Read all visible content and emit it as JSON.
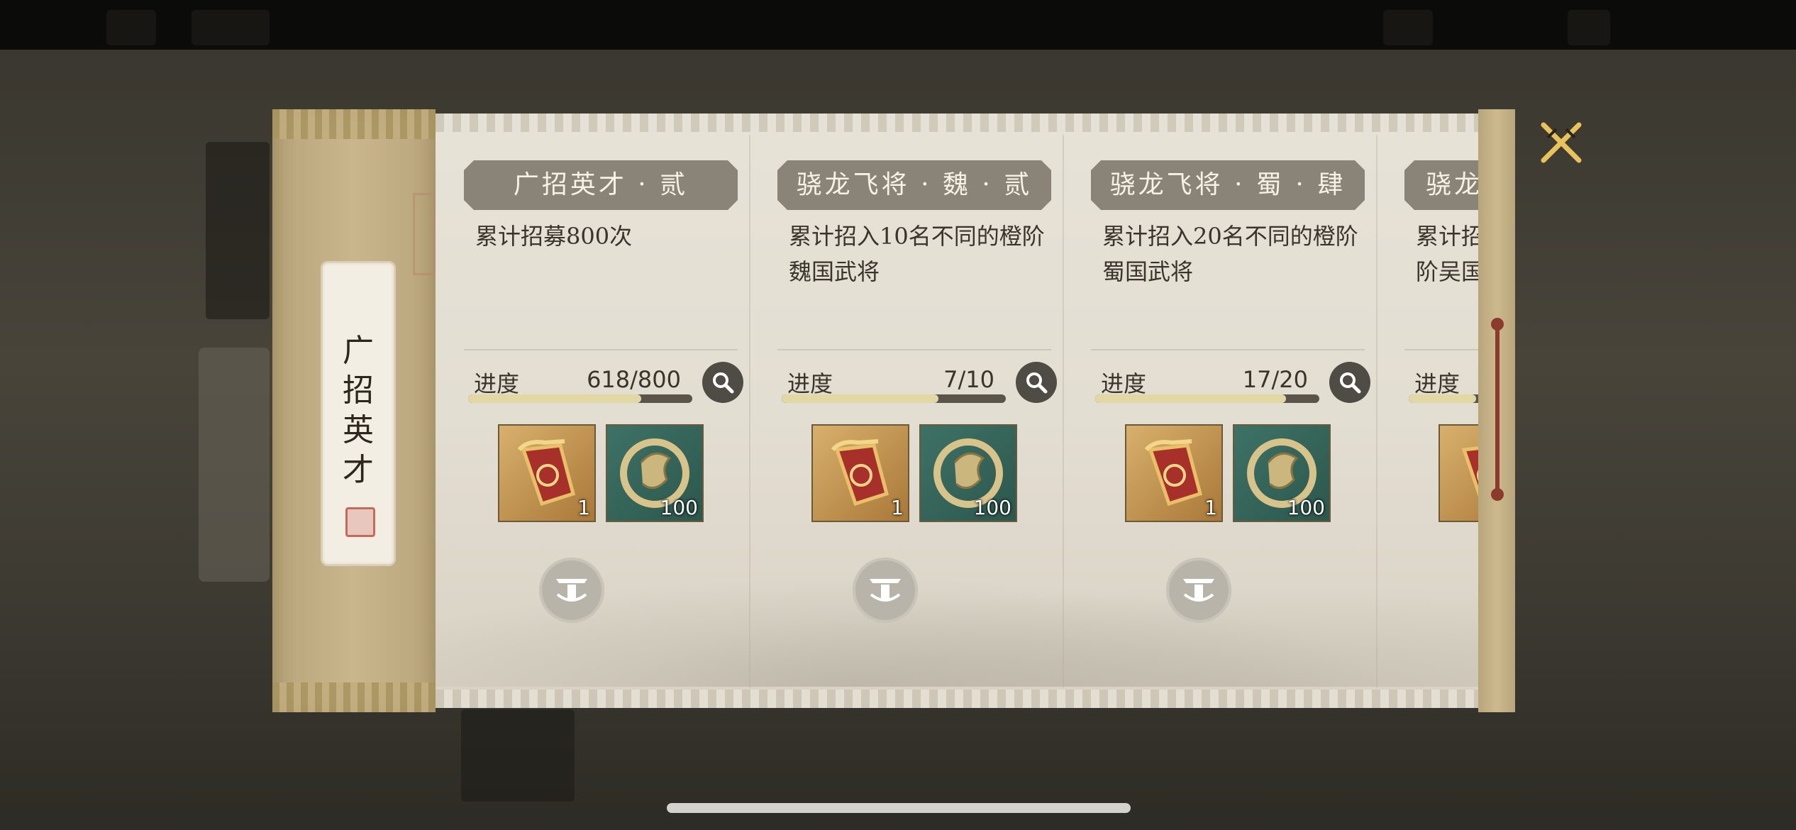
{
  "left_tab": {
    "label": "广\n招\n英\n才"
  },
  "cards": [
    {
      "title": "广招英才 · 贰",
      "description": "累计招募800次",
      "progress_label": "进度",
      "progress_value": "618/800",
      "progress": 0.7725,
      "rewards": [
        {
          "icon": "recruit-token-icon",
          "count": "1"
        },
        {
          "icon": "jade-dragon-icon",
          "count": "100"
        }
      ]
    },
    {
      "title": "骁龙飞将 · 魏 · 贰",
      "description": "累计招入10名不同的橙阶魏国武将",
      "progress_label": "进度",
      "progress_value": "7/10",
      "progress": 0.7,
      "rewards": [
        {
          "icon": "recruit-token-icon",
          "count": "1"
        },
        {
          "icon": "jade-dragon-icon",
          "count": "100"
        }
      ]
    },
    {
      "title": "骁龙飞将 · 蜀 · 肆",
      "description": "累计招入20名不同的橙阶蜀国武将",
      "progress_label": "进度",
      "progress_value": "17/20",
      "progress": 0.85,
      "rewards": [
        {
          "icon": "recruit-token-icon",
          "count": "1"
        },
        {
          "icon": "jade-dragon-icon",
          "count": "100"
        }
      ]
    },
    {
      "title": "骁龙",
      "description": "累计招\n阶吴国",
      "progress_label": "进度",
      "progress_value": "",
      "progress": 0.3,
      "rewards": [
        {
          "icon": "recruit-token-icon",
          "count": ""
        }
      ]
    }
  ],
  "colors": {
    "title_bg": "#8a8377",
    "progress_fill": "#e2d8a6",
    "accent_red": "#8b3a2c"
  }
}
